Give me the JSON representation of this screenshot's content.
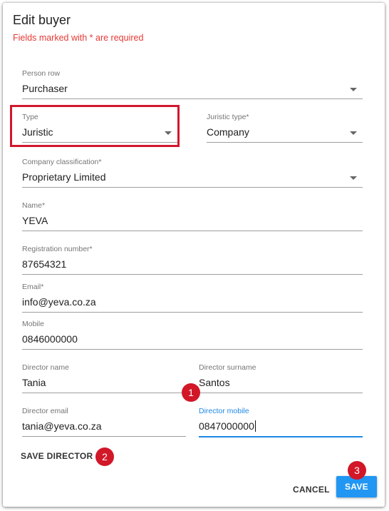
{
  "dialog": {
    "title": "Edit buyer",
    "subtitle": "Fields marked with * are required"
  },
  "fields": {
    "person_row": {
      "label": "Person row",
      "value": "Purchaser"
    },
    "type": {
      "label": "Type",
      "value": "Juristic"
    },
    "juristic_type": {
      "label": "Juristic type*",
      "value": "Company"
    },
    "company_classification": {
      "label": "Company classification*",
      "value": "Proprietary Limited"
    },
    "name": {
      "label": "Name*",
      "value": "YEVA"
    },
    "registration_number": {
      "label": "Registration number*",
      "value": "87654321"
    },
    "email": {
      "label": "Email*",
      "value": "info@yeva.co.za"
    },
    "mobile": {
      "label": "Mobile",
      "value": "0846000000"
    },
    "director_name": {
      "label": "Director name",
      "value": "Tania"
    },
    "director_surname": {
      "label": "Director surname",
      "value": "Santos"
    },
    "director_email": {
      "label": "Director email",
      "value": "tania@yeva.co.za"
    },
    "director_mobile": {
      "label": "Director mobile",
      "value": "0847000000"
    }
  },
  "buttons": {
    "save_director": "SAVE DIRECTOR",
    "cancel": "CANCEL",
    "save": "SAVE"
  },
  "annotations": {
    "badge_1": "1",
    "badge_2": "2",
    "badge_3": "3"
  },
  "colors": {
    "accent": "#2196f3",
    "required_text": "#e53935",
    "highlight": "#d3172d",
    "badge": "#d11728"
  },
  "icons": {
    "dropdown": "arrow-drop-down-icon"
  }
}
